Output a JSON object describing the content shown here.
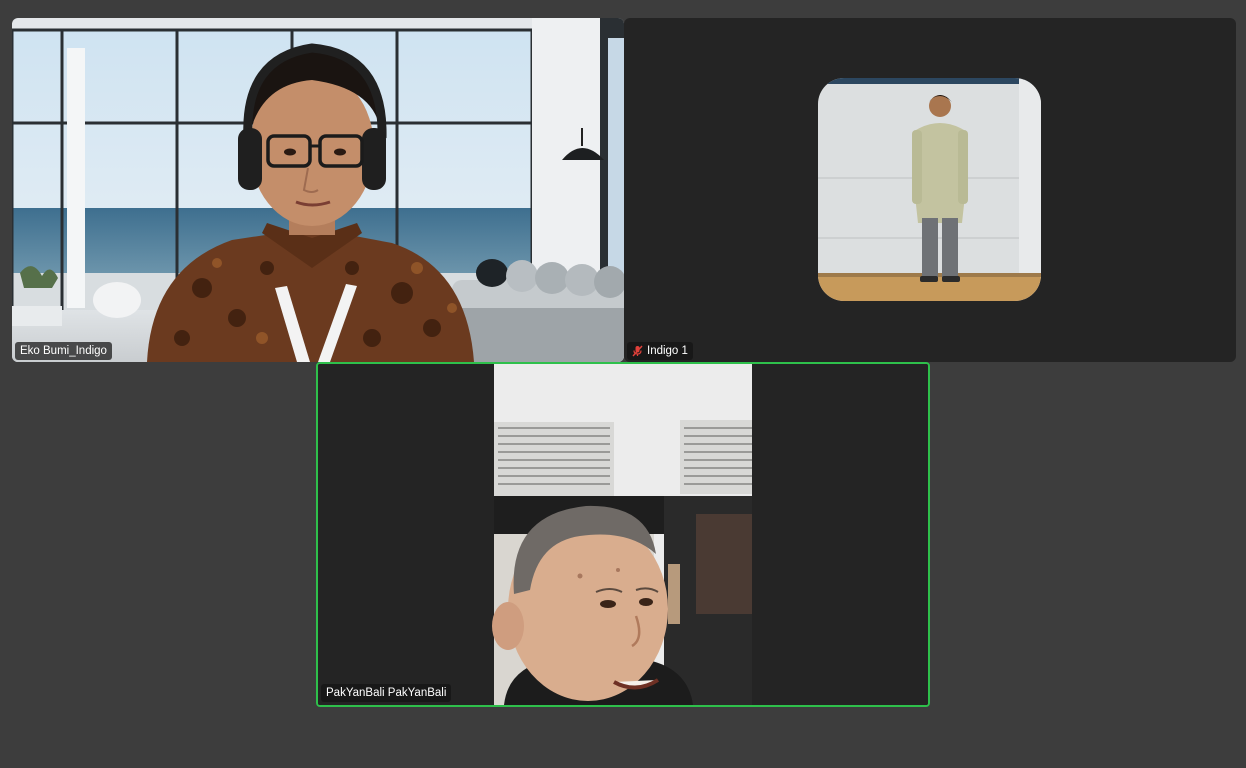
{
  "participants": [
    {
      "id": "eko",
      "name": "Eko Bumi_Indigo",
      "muted": false,
      "active_speaker": false
    },
    {
      "id": "indigo",
      "name": "Indigo 1",
      "muted": true,
      "active_speaker": false
    },
    {
      "id": "pak",
      "name": "PakYanBali PakYanBali",
      "muted": false,
      "active_speaker": true
    }
  ],
  "colors": {
    "background": "#3d3d3d",
    "tile": "#242424",
    "active_speaker_border": "#2ec04b",
    "muted_icon": "#e0403a"
  },
  "icons": {
    "muted": "mic-muted-icon"
  }
}
